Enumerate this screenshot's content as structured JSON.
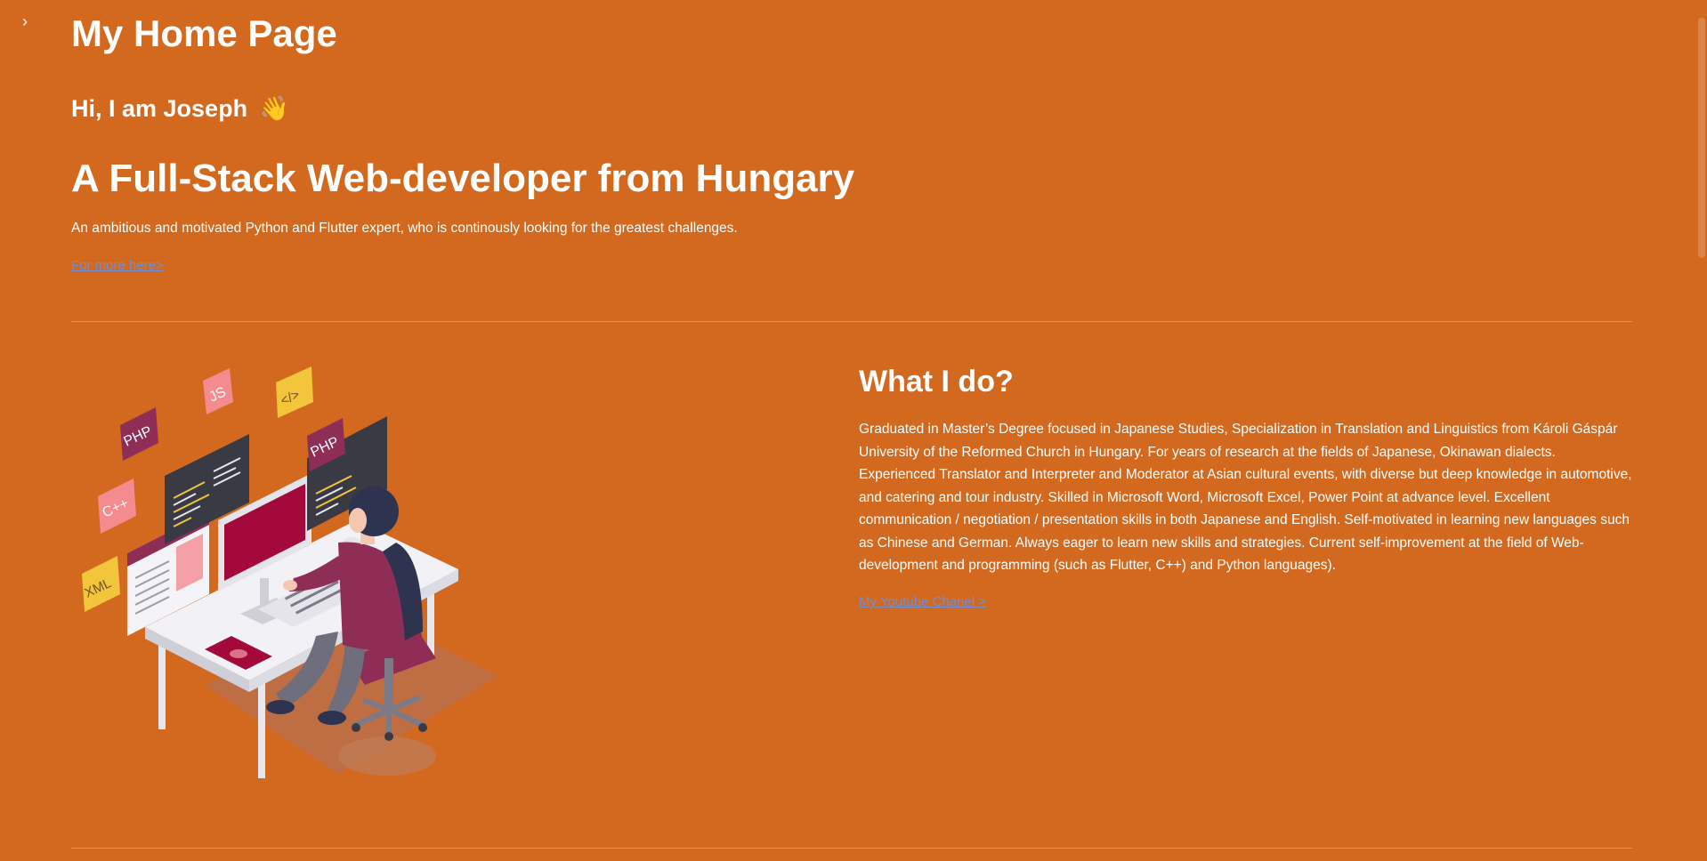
{
  "sidebar": {
    "toggle_glyph": "›",
    "toggle_icon": "chevron-right-icon"
  },
  "header": {
    "title": "My Home Page",
    "greeting": "Hi, I am Joseph",
    "greeting_emoji": "👋",
    "headline": "A Full-Stack Web-developer from Hungary",
    "intro": "An ambitious and motivated Python and Flutter expert, who is continously looking for the greatest challenges.",
    "more_link": "For more here>"
  },
  "about": {
    "title": "What I do?",
    "body": "Graduated in Master’s Degree focused in Japanese Studies, Specialization in Translation and Linguistics from Károli Gáspár University of the Reformed Church in Hungary. For years of research at the fields of Japanese, Okinawan dialects. Experienced Translator and Interpreter and Moderator at Asian cultural events, with diverse but deep knowledge in automotive, and catering and tour industry. Skilled in Microsoft Word, Microsoft Excel, Power Point at advance level. Excellent communication / negotiation / presentation skills in both Japanese and English. Self-motivated in learning new languages such as Chinese and German. Always eager to learn new skills and strategies. Current self-improvement at the field of Web-development and programming (such as Flutter, C++) and Python languages).",
    "youtube_link": "My Youtube Chanel >",
    "illustration_badges": {
      "php_left": "PHP",
      "js": "JS",
      "code": "</>",
      "php_right": "PHP",
      "cpp": "C++",
      "xml": "XML"
    }
  },
  "colors": {
    "background": "#d2691f",
    "link": "#6f8fd6",
    "text": "#ffffff"
  }
}
